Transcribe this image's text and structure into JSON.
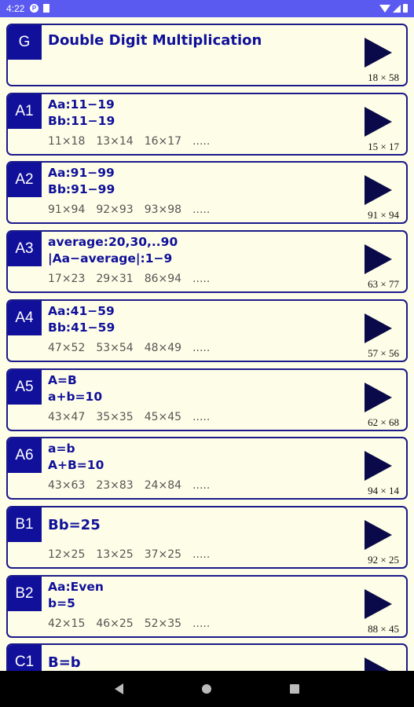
{
  "status": {
    "time": "4:22"
  },
  "cards": [
    {
      "id": "G",
      "lines": [
        "Double Digit Multiplication"
      ],
      "examples": [],
      "sample": "18 × 58"
    },
    {
      "id": "A1",
      "lines": [
        "Aa:11−19",
        "Bb:11−19"
      ],
      "examples": [
        "11×18",
        "13×14",
        "16×17",
        "....."
      ],
      "sample": "15 × 17"
    },
    {
      "id": "A2",
      "lines": [
        "Aa:91−99",
        "Bb:91−99"
      ],
      "examples": [
        "91×94",
        "92×93",
        "93×98",
        "....."
      ],
      "sample": "91 × 94"
    },
    {
      "id": "A3",
      "lines": [
        "average:20,30,..90",
        "|Aa−average|:1−9"
      ],
      "examples": [
        "17×23",
        "29×31",
        "86×94",
        "....."
      ],
      "sample": "63 × 77"
    },
    {
      "id": "A4",
      "lines": [
        "Aa:41−59",
        "Bb:41−59"
      ],
      "examples": [
        "47×52",
        "53×54",
        "48×49",
        "....."
      ],
      "sample": "57 × 56"
    },
    {
      "id": "A5",
      "lines": [
        "A=B",
        "a+b=10"
      ],
      "examples": [
        "43×47",
        "35×35",
        "45×45",
        "....."
      ],
      "sample": "62 × 68"
    },
    {
      "id": "A6",
      "lines": [
        "a=b",
        "A+B=10"
      ],
      "examples": [
        "43×63",
        "23×83",
        "24×84",
        "....."
      ],
      "sample": "94 × 14"
    },
    {
      "id": "B1",
      "lines": [
        "Bb=25"
      ],
      "examples": [
        "12×25",
        "13×25",
        "37×25",
        "....."
      ],
      "sample": "92 × 25"
    },
    {
      "id": "B2",
      "lines": [
        "Aa:Even",
        "b=5"
      ],
      "examples": [
        "42×15",
        "46×25",
        "52×35",
        "....."
      ],
      "sample": "88 × 45"
    },
    {
      "id": "C1",
      "lines": [
        "B=b"
      ],
      "examples": [],
      "sample": ""
    }
  ]
}
